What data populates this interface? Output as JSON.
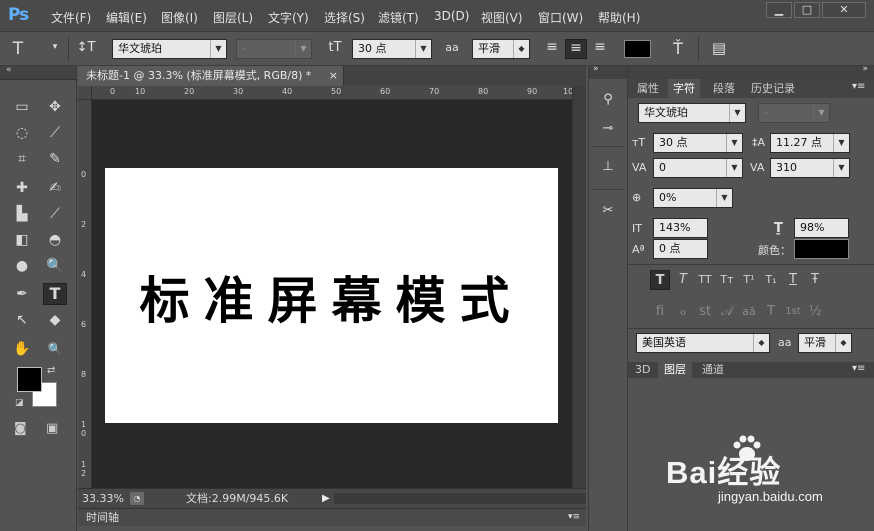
{
  "app": {
    "logo": "Ps"
  },
  "menu": [
    "文件(F)",
    "编辑(E)",
    "图像(I)",
    "图层(L)",
    "文字(Y)",
    "选择(S)",
    "滤镜(T)",
    "3D(D)",
    "视图(V)",
    "窗口(W)",
    "帮助(H)"
  ],
  "window_controls": {
    "minimize": "▁",
    "maximize": "□",
    "close": "✕"
  },
  "options": {
    "tool_icon": "T",
    "tool_dropdown": "▾",
    "orient_icon": "↕T",
    "font_family": "华文琥珀",
    "font_style": "-",
    "size_icon": "tT",
    "font_size": "30 点",
    "aa_icon": "aa",
    "antialias": "平滑",
    "align_icons": [
      "≡",
      "≡",
      "≡"
    ],
    "color_hex": "#000000",
    "warp_icon": "Ť",
    "panel_icon": "▤"
  },
  "document": {
    "tab_title": "未标题-1 @ 33.3% (标准屏幕模式, RGB/8) *",
    "tab_close": "×",
    "canvas_text": "标准屏幕模式",
    "zoom": "33.33%",
    "doc_info": "文档:2.99M/945.6K",
    "ruler_top": [
      "0",
      "10",
      "20",
      "30",
      "40",
      "50",
      "60",
      "70",
      "80",
      "90",
      "10"
    ],
    "ruler_left": [
      "0",
      "2",
      "4",
      "6",
      "8",
      "1\n0",
      "1\n2"
    ]
  },
  "tools": [
    [
      "▭",
      "✥"
    ],
    [
      "◌",
      "⟋"
    ],
    [
      "⌗",
      "✎"
    ],
    [
      "✚",
      "✍"
    ],
    [
      "▙",
      "⟋"
    ],
    [
      "◧",
      "◓"
    ],
    [
      "●",
      "🔍"
    ],
    [
      "✒",
      "T"
    ],
    [
      "↖",
      "◆"
    ],
    [
      "✋",
      "🔍"
    ]
  ],
  "timeline": {
    "label": "时间轴"
  },
  "character_panel": {
    "tabs": [
      "属性",
      "字符",
      "段落",
      "历史记录"
    ],
    "font_family": "华文琥珀",
    "font_style": "-",
    "font_size": "30 点",
    "leading": "11.27 点",
    "kerning": "0",
    "tracking": "310",
    "tsume": "0%",
    "vertical_scale": "143%",
    "horizontal_scale": "98%",
    "baseline_shift": "0 点",
    "color_label": "颜色：",
    "color_hex": "#000000",
    "style_buttons": [
      "T",
      "T",
      "TT",
      "Tт",
      "T¹",
      "T₁",
      "T",
      "Ŧ"
    ],
    "opentype_buttons": [
      "fi",
      "ℴ",
      "st",
      "𝒜",
      "aā",
      "T",
      "1st",
      "½"
    ],
    "language": "美国英语",
    "antialias_icon": "aa",
    "antialias": "平滑"
  },
  "layers_panel": {
    "tabs": [
      "3D",
      "图层",
      "通道"
    ]
  },
  "watermark": {
    "brand": "Bai经验",
    "url": "jingyan.baidu.com"
  }
}
